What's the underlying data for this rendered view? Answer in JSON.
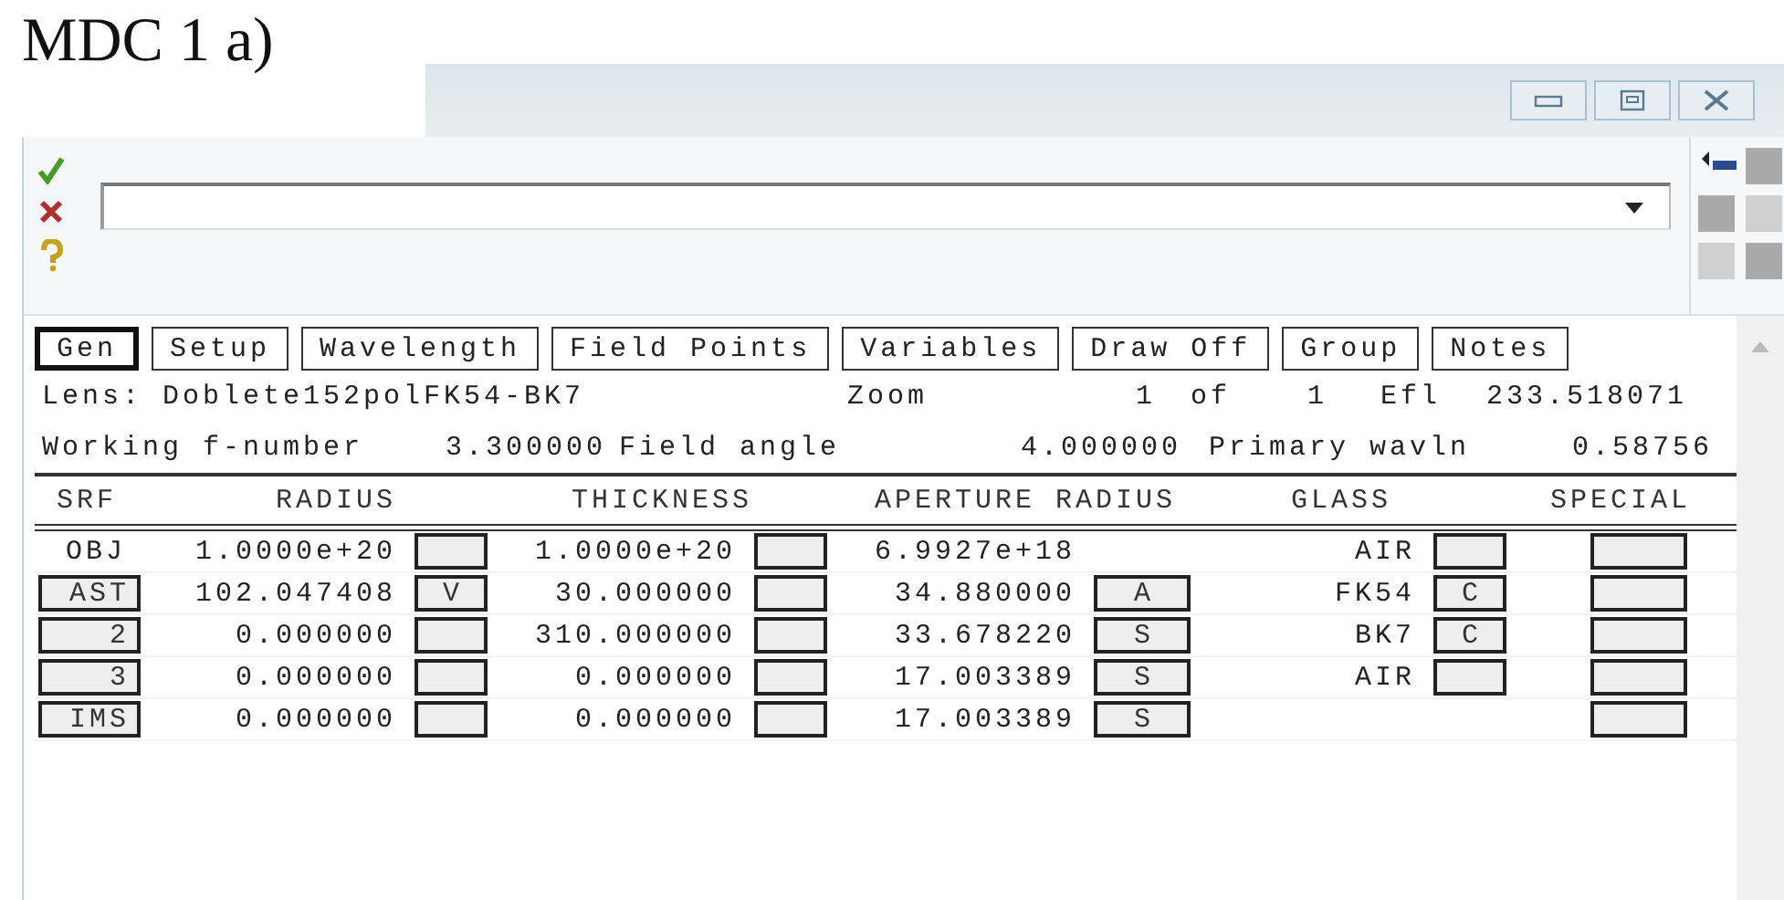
{
  "caption": "MDC 1 a)",
  "tabs": [
    {
      "label": "Gen",
      "selected": true
    },
    {
      "label": "Setup",
      "selected": false
    },
    {
      "label": "Wavelength",
      "selected": false
    },
    {
      "label": "Field Points",
      "selected": false
    },
    {
      "label": "Variables",
      "selected": false
    },
    {
      "label": "Draw Off",
      "selected": false
    },
    {
      "label": "Group",
      "selected": false
    },
    {
      "label": "Notes",
      "selected": false
    }
  ],
  "info_lines": [
    [
      "Lens: Doblete152polFK54-BK7",
      "Zoom",
      "1",
      "of",
      "1",
      "Efl",
      "233.518071"
    ],
    [
      "Working f-number",
      "3.300000",
      "Field angle",
      "4.000000",
      "Primary wavln",
      "0.58756"
    ]
  ],
  "columns": [
    "SRF",
    "RADIUS",
    "THICKNESS",
    "APERTURE RADIUS",
    "GLASS",
    "SPECIAL"
  ],
  "rows": [
    {
      "srf": "OBJ",
      "srf_button": false,
      "radius": "1.0000e+20",
      "thickness": "1.0000e+20",
      "aperture": "6.9927e+18",
      "aperture_box": false,
      "glass": "AIR",
      "glass_box": true
    },
    {
      "srf": "AST",
      "srf_button": true,
      "radius": "102.047408",
      "radius_solve": "V",
      "thickness": "30.000000",
      "aperture": "34.880000",
      "aperture_box": true,
      "aperture_solve": "A",
      "glass": "FK54",
      "glass_box": true,
      "glass_solve": "C"
    },
    {
      "srf": "2",
      "srf_button": true,
      "radius": "0.000000",
      "thickness": "310.000000",
      "aperture": "33.678220",
      "aperture_box": true,
      "aperture_solve": "S",
      "glass": "BK7",
      "glass_box": true,
      "glass_solve": "C"
    },
    {
      "srf": "3",
      "srf_button": true,
      "radius": "0.000000",
      "thickness": "0.000000",
      "aperture": "17.003389",
      "aperture_box": true,
      "aperture_solve": "S",
      "glass": "AIR",
      "glass_box": true
    },
    {
      "srf": "IMS",
      "srf_button": true,
      "radius": "0.000000",
      "thickness": "0.000000",
      "aperture": "17.003389",
      "aperture_box": true,
      "aperture_solve": "S",
      "glass_box": false
    }
  ]
}
